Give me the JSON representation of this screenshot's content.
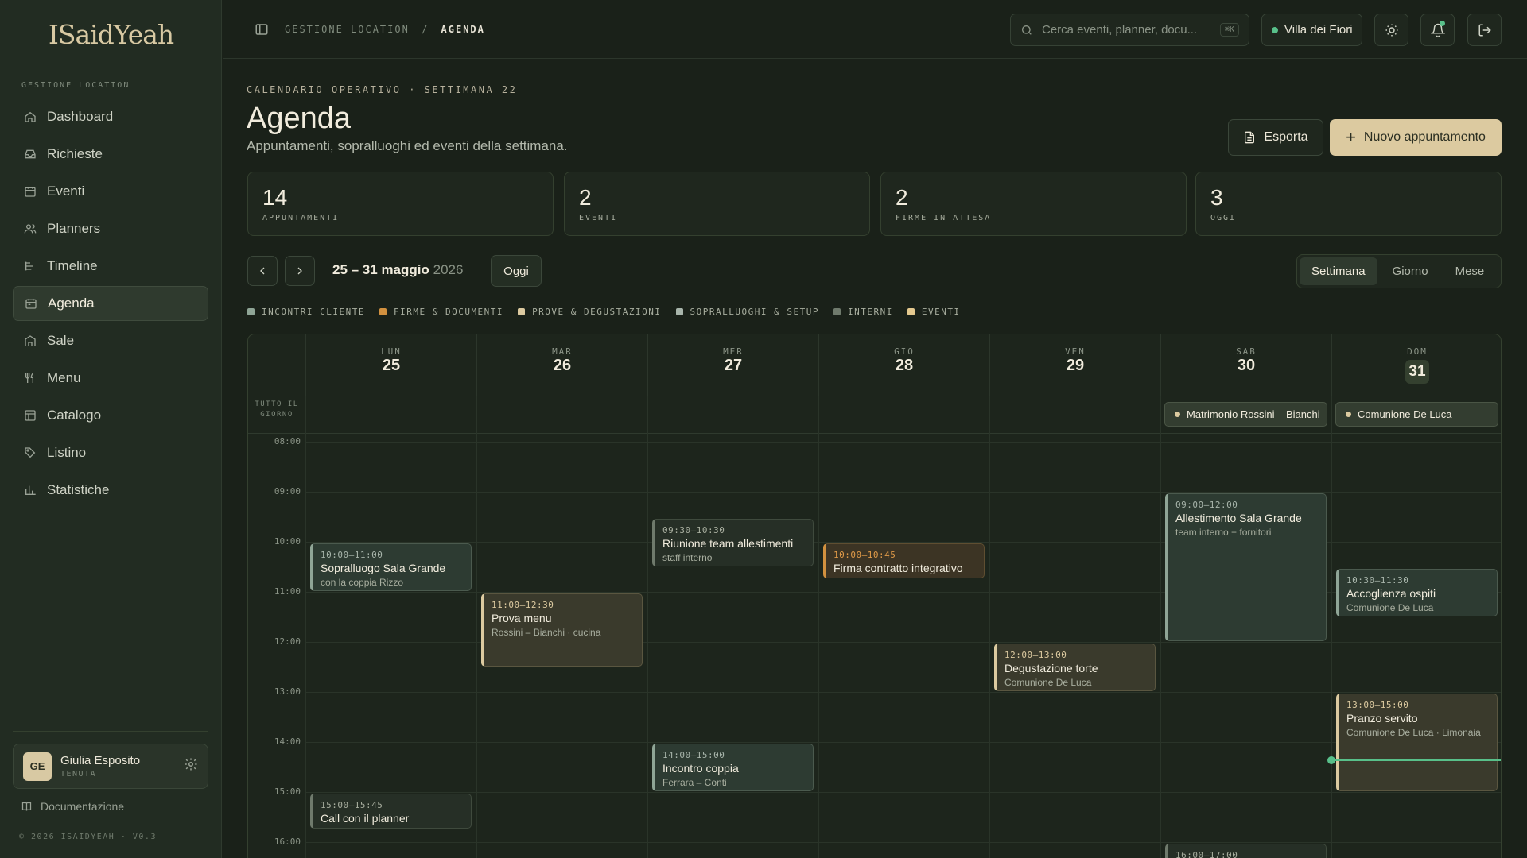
{
  "app": {
    "logo_text": "ISaidYeah"
  },
  "sidebar": {
    "section_label": "GESTIONE LOCATION",
    "items": [
      {
        "label": "Dashboard",
        "icon": "home-icon"
      },
      {
        "label": "Richieste",
        "icon": "inbox-icon"
      },
      {
        "label": "Eventi",
        "icon": "calendar-icon"
      },
      {
        "label": "Planners",
        "icon": "users-icon"
      },
      {
        "label": "Timeline",
        "icon": "timeline-icon"
      },
      {
        "label": "Agenda",
        "icon": "agenda-icon",
        "active": true
      },
      {
        "label": "Sale",
        "icon": "building-icon"
      },
      {
        "label": "Menu",
        "icon": "utensils-icon"
      },
      {
        "label": "Catalogo",
        "icon": "grid-icon"
      },
      {
        "label": "Listino",
        "icon": "tag-icon"
      },
      {
        "label": "Statistiche",
        "icon": "bar-chart-icon"
      }
    ],
    "user": {
      "initials": "GE",
      "name": "Giulia Esposito",
      "role": "TENUTA"
    },
    "doc_link": "Documentazione",
    "copyright": "© 2026 ISAIDYEAH · V0.3"
  },
  "topbar": {
    "breadcrumb_parent": "GESTIONE LOCATION",
    "breadcrumb_sep": "/",
    "breadcrumb_current": "AGENDA",
    "search_placeholder": "Cerca eventi, planner, docu...",
    "search_shortcut": "⌘K",
    "venue": "Villa dei Fiori"
  },
  "header": {
    "eyebrow": "CALENDARIO OPERATIVO · SETTIMANA 22",
    "title": "Agenda",
    "subtitle": "Appuntamenti, sopralluoghi ed eventi della settimana.",
    "export_label": "Esporta",
    "new_label": "Nuovo appuntamento"
  },
  "stats": [
    {
      "value": "14",
      "label": "APPUNTAMENTI"
    },
    {
      "value": "2",
      "label": "EVENTI"
    },
    {
      "value": "2",
      "label": "FIRME IN ATTESA"
    },
    {
      "value": "3",
      "label": "OGGI"
    }
  ],
  "calnav": {
    "range": "25 – 31 maggio",
    "year": "2026",
    "today_label": "Oggi",
    "views": [
      "Settimana",
      "Giorno",
      "Mese"
    ],
    "active_view": "Settimana"
  },
  "legend": [
    {
      "label": "INCONTRI CLIENTE",
      "color": "#8fa596"
    },
    {
      "label": "FIRME & DOCUMENTI",
      "color": "#d2913f"
    },
    {
      "label": "PROVE & DEGUSTAZIONI",
      "color": "#dccaa0"
    },
    {
      "label": "SOPRALLUOGHI & SETUP",
      "color": "#a8b5ab"
    },
    {
      "label": "INTERNI",
      "color": "#6f7a6c"
    },
    {
      "label": "EVENTI",
      "color": "#e4c98f"
    }
  ],
  "calendar": {
    "allday_label": "TUTTO IL GIORNO",
    "days": [
      {
        "name": "LUN",
        "num": "25"
      },
      {
        "name": "MAR",
        "num": "26"
      },
      {
        "name": "MER",
        "num": "27"
      },
      {
        "name": "GIO",
        "num": "28"
      },
      {
        "name": "VEN",
        "num": "29"
      },
      {
        "name": "SAB",
        "num": "30"
      },
      {
        "name": "DOM",
        "num": "31",
        "today": true
      }
    ],
    "hours": [
      "08:00",
      "09:00",
      "10:00",
      "11:00",
      "12:00",
      "13:00",
      "14:00",
      "15:00",
      "16:00"
    ],
    "allday_events": [
      {
        "day": 5,
        "title": "Matrimonio Rossini – Bianchi"
      },
      {
        "day": 6,
        "title": "Comunione De Luca"
      }
    ],
    "events": [
      {
        "day": 0,
        "start": 10.0,
        "end": 11.0,
        "time": "10:00–11:00",
        "title": "Sopralluogo Sala Grande",
        "desc": "con la coppia Rizzo",
        "kind": "teal"
      },
      {
        "day": 0,
        "start": 15.0,
        "end": 15.75,
        "time": "15:00–15:45",
        "title": "Call con il planner",
        "desc": "",
        "kind": "slate"
      },
      {
        "day": 1,
        "start": 11.0,
        "end": 12.5,
        "time": "11:00–12:30",
        "title": "Prova menu",
        "desc": "Rossini – Bianchi · cucina",
        "kind": "sand"
      },
      {
        "day": 2,
        "start": 9.5,
        "end": 10.5,
        "time": "09:30–10:30",
        "title": "Riunione team allestimenti",
        "desc": "staff interno",
        "kind": "slate"
      },
      {
        "day": 2,
        "start": 14.0,
        "end": 15.0,
        "time": "14:00–15:00",
        "title": "Incontro coppia",
        "desc": "Ferrara – Conti",
        "kind": "teal"
      },
      {
        "day": 3,
        "start": 10.0,
        "end": 10.75,
        "time": "10:00–10:45",
        "title": "Firma contratto integrativo",
        "desc": "",
        "kind": "orange"
      },
      {
        "day": 4,
        "start": 12.0,
        "end": 13.0,
        "time": "12:00–13:00",
        "title": "Degustazione torte",
        "desc": "Comunione De Luca",
        "kind": "sand"
      },
      {
        "day": 5,
        "start": 9.0,
        "end": 12.0,
        "time": "09:00–12:00",
        "title": "Allestimento Sala Grande",
        "desc": "team interno + fornitori",
        "kind": "teal"
      },
      {
        "day": 5,
        "start": 16.0,
        "end": 17.0,
        "time": "16:00–17:00",
        "title": "",
        "desc": "",
        "kind": "slate"
      },
      {
        "day": 6,
        "start": 10.5,
        "end": 11.5,
        "time": "10:30–11:30",
        "title": "Accoglienza ospiti",
        "desc": "Comunione De Luca",
        "kind": "teal"
      },
      {
        "day": 6,
        "start": 13.0,
        "end": 15.0,
        "time": "13:00–15:00",
        "title": "Pranzo servito",
        "desc": "Comunione De Luca · Limonaia",
        "kind": "sand"
      }
    ],
    "now_hour": 14.35
  }
}
